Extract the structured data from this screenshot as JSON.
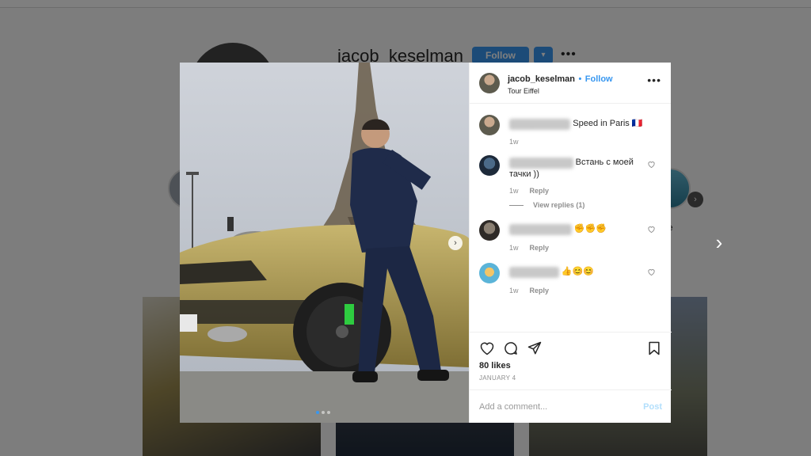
{
  "colors": {
    "accent": "#3897f0",
    "text": "#262626",
    "muted": "#8e8e8e"
  },
  "background_profile": {
    "username": "jacob_keselman",
    "follow_label": "Follow",
    "dropdown_glyph": "▾",
    "more_glyph": "•••",
    "highlight_label": "ce",
    "next_glyph": "›"
  },
  "modal": {
    "header": {
      "username": "jacob_keselman",
      "separator": "•",
      "follow_label": "Follow",
      "location": "Tour Eiffel",
      "more_glyph": "•••"
    },
    "comments": [
      {
        "name_blurred": "jacob_keselman",
        "text": "Speed in Paris 🇫🇷",
        "time": "1w"
      },
      {
        "name_blurred": "maxim___official",
        "text": "Встань с моей тачки ))",
        "time": "1w",
        "reply_label": "Reply",
        "view_replies": "View replies (1)"
      },
      {
        "name_blurred": "lucasbrown.ldgs",
        "text": "✊✊✊",
        "time": "1w",
        "reply_label": "Reply"
      },
      {
        "name_blurred": "alexepatelien",
        "text": "👍😊😊",
        "time": "1w",
        "reply_label": "Reply"
      }
    ],
    "likes": "80 likes",
    "date": "JANUARY 4",
    "comment_placeholder": "Add a comment...",
    "post_label": "Post",
    "media": {
      "slides": 3,
      "current_slide": 1,
      "next_glyph": "›"
    }
  },
  "icons": [
    "heart-icon",
    "comment-icon",
    "share-icon",
    "bookmark-icon",
    "chevron-right-icon",
    "more-icon"
  ]
}
